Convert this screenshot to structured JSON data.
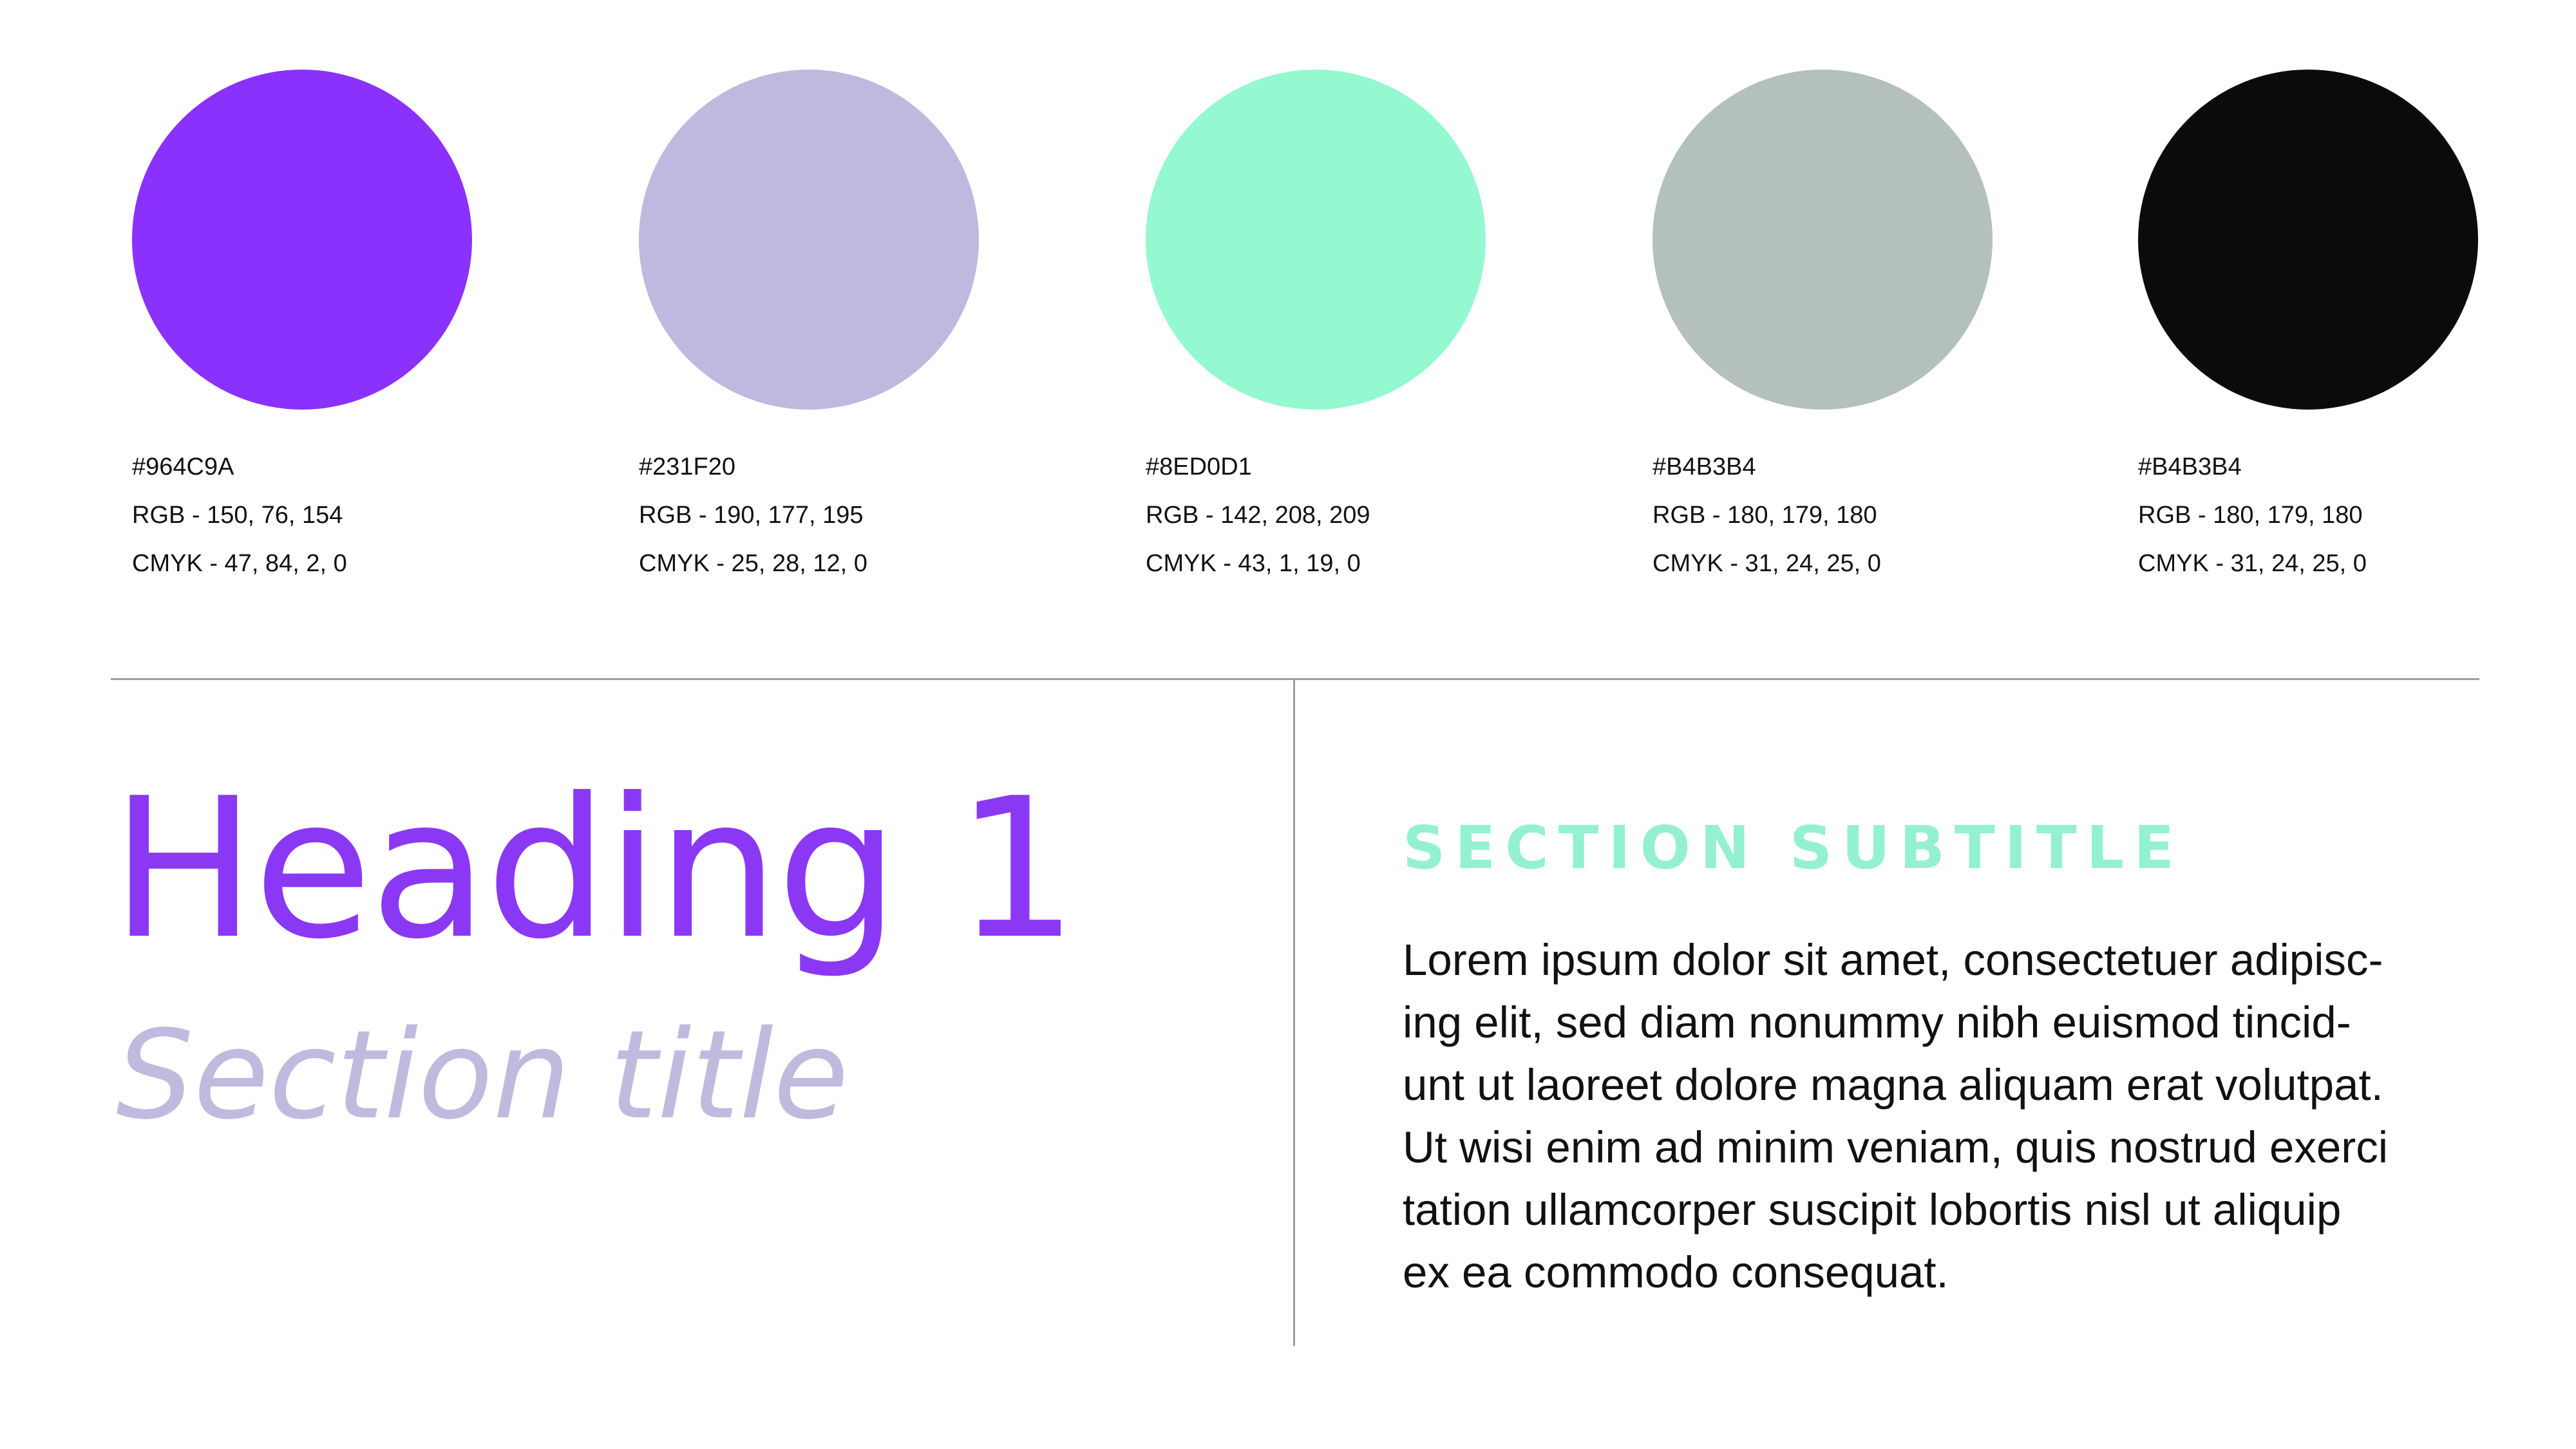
{
  "swatches": [
    {
      "color": "#8b31fd",
      "hex_label": "#964C9A",
      "rgb_label": "RGB - 150, 76, 154",
      "cmyk_label": "CMYK - 47, 84, 2, 0"
    },
    {
      "color": "#bfb8df",
      "hex_label": "#231F20",
      "rgb_label": "RGB - 190, 177, 195",
      "cmyk_label": "CMYK - 25, 28, 12, 0"
    },
    {
      "color": "#94f8d1",
      "hex_label": "#8ED0D1",
      "rgb_label": "RGB - 142, 208, 209",
      "cmyk_label": "CMYK - 43, 1, 19, 0"
    },
    {
      "color": "#b3c0bd",
      "hex_label": "#B4B3B4",
      "rgb_label": "RGB - 180, 179, 180",
      "cmyk_label": "CMYK - 31, 24, 25, 0"
    },
    {
      "color": "#0a0c0b",
      "hex_label": "#B4B3B4",
      "rgb_label": "RGB - 180, 179, 180",
      "cmyk_label": "CMYK - 31, 24, 25, 0"
    }
  ],
  "typography": {
    "heading_1": "Heading 1",
    "section_title": "Section title",
    "section_subtitle": "SECTION SUBTITLE",
    "body_lines": [
      "Lorem ipsum dolor sit amet, consectetuer adipisc-",
      "ing elit, sed diam nonummy nibh euismod tincid-",
      "unt ut laoreet dolore magna aliquam erat volutpat.",
      "Ut wisi enim ad minim veniam, quis nostrud exerci",
      "tation ullamcorper suscipit lobortis nisl ut aliquip",
      "ex ea commodo consequat."
    ]
  }
}
